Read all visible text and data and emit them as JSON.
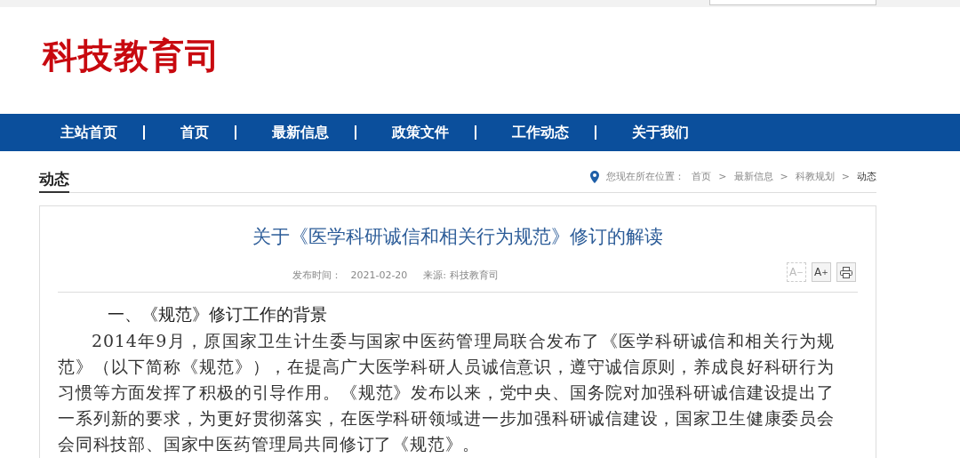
{
  "site_title": "科技教育司",
  "nav": [
    {
      "label": "主站首页"
    },
    {
      "label": "首页"
    },
    {
      "label": "最新信息"
    },
    {
      "label": "政策文件"
    },
    {
      "label": "工作动态"
    },
    {
      "label": "关于我们"
    }
  ],
  "section_title": "动态",
  "breadcrumb": {
    "prefix": "您现在所在位置：",
    "items": [
      "首页",
      "最新信息",
      "科教规划",
      "动态"
    ],
    "separator": ">"
  },
  "article": {
    "title": "关于《医学科研诚信和相关行为规范》修订的解读",
    "published_label": "发布时间：",
    "published": "2021-02-20",
    "source": "来源: 科技教育司",
    "tools": [
      {
        "kind": "smaller",
        "label": "A",
        "mark": "−",
        "disabled": true
      },
      {
        "kind": "larger",
        "label": "A",
        "mark": "+",
        "disabled": false
      },
      {
        "kind": "print",
        "disabled": false
      }
    ],
    "heading": "一、《规范》修订工作的背景",
    "paragraph": "2014年9月，原国家卫生计生委与国家中医药管理局联合发布了《医学科研诚信和相关行为规范》（以下简称《规范》），在提高广大医学科研人员诚信意识，遵守诚信原则，养成良好科研行为习惯等方面发挥了积极的引导作用。《规范》发布以来，党中央、国务院对加强科研诚信建设提出了一系列新的要求，为更好贯彻落实，在医学科研领域进一步加强科研诚信建设，国家卫生健康委员会会同科技部、国家中医药管理局共同修订了《规范》。"
  }
}
